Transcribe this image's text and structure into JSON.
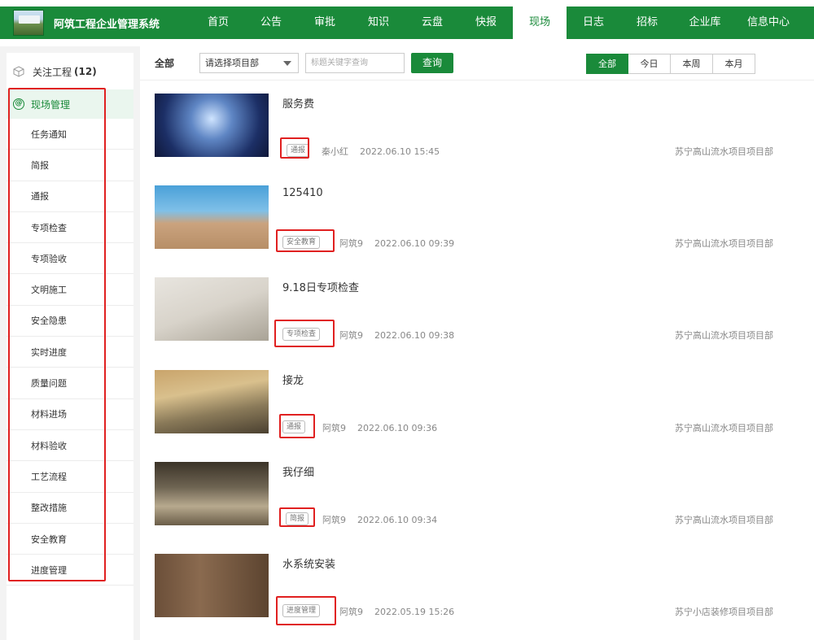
{
  "header": {
    "app_title": "阿筑工程企业管理系统",
    "nav": [
      {
        "label": "首页",
        "width": 64
      },
      {
        "label": "公告",
        "width": 66
      },
      {
        "label": "审批",
        "width": 66
      },
      {
        "label": "知识",
        "width": 66
      },
      {
        "label": "云盘",
        "width": 66
      },
      {
        "label": "快报",
        "width": 66
      },
      {
        "label": "现场",
        "width": 66,
        "active": true
      },
      {
        "label": "日志",
        "width": 66
      },
      {
        "label": "招标",
        "width": 66
      },
      {
        "label": "企业库",
        "width": 76
      },
      {
        "label": "信息中心",
        "width": 80
      }
    ]
  },
  "sidebar": {
    "follow_label": "关注工程",
    "follow_count": "(12)",
    "section_label": "现场管理",
    "items": [
      "任务通知",
      "简报",
      "通报",
      "专项检查",
      "专项验收",
      "文明施工",
      "安全隐患",
      "实时进度",
      "质量问题",
      "材料进场",
      "材料验收",
      "工艺流程",
      "整改措施",
      "安全教育",
      "进度管理"
    ]
  },
  "toolbar": {
    "all_label": "全部",
    "project_select": "请选择项目部",
    "search_placeholder": "标题关键字查询",
    "query_label": "查询",
    "periods": [
      {
        "label": "全部",
        "active": true
      },
      {
        "label": "今日"
      },
      {
        "label": "本周"
      },
      {
        "label": "本月"
      }
    ]
  },
  "posts": [
    {
      "title": "服务费",
      "tag": "通报",
      "author": "秦小红",
      "time": "2022.06.10 15:45",
      "project": "苏宁高山流水项目项目部",
      "thumb": "t1"
    },
    {
      "title": "125410",
      "tag": "安全教育",
      "author": "阿筑9",
      "time": "2022.06.10 09:39",
      "project": "苏宁高山流水项目项目部",
      "thumb": "t2"
    },
    {
      "title": "9.18日专项检查",
      "tag": "专项检查",
      "author": "阿筑9",
      "time": "2022.06.10 09:38",
      "project": "苏宁高山流水项目项目部",
      "thumb": "t3"
    },
    {
      "title": "接龙",
      "tag": "通报",
      "author": "阿筑9",
      "time": "2022.06.10 09:36",
      "project": "苏宁高山流水项目项目部",
      "thumb": "t4"
    },
    {
      "title": "我仔细",
      "tag": "简报",
      "author": "阿筑9",
      "time": "2022.06.10 09:34",
      "project": "苏宁高山流水项目项目部",
      "thumb": "t5"
    },
    {
      "title": "水系统安装",
      "tag": "进度管理",
      "author": "阿筑9",
      "time": "2022.05.19 15:26",
      "project": "苏宁小店装修项目项目部",
      "thumb": "t6"
    }
  ],
  "colors": {
    "brand": "#1a8a3a",
    "highlight": "#e02020"
  }
}
